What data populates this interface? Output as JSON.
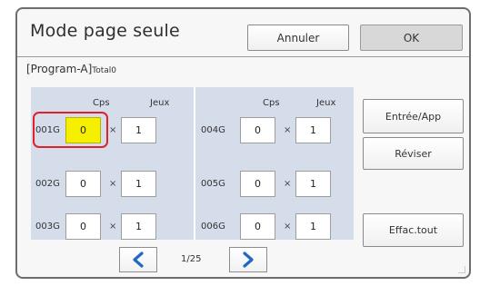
{
  "dialog": {
    "title": "Mode page seule",
    "cancel_label": "Annuler",
    "ok_label": "OK"
  },
  "program": {
    "name": "[Program-A]",
    "total": "Total0"
  },
  "grid": {
    "left": {
      "header_cps": "Cps",
      "header_jeux": "Jeux",
      "rows": [
        {
          "label": "001G",
          "cps": "0",
          "times": "×",
          "jeux": "1"
        },
        {
          "label": "002G",
          "cps": "0",
          "times": "×",
          "jeux": "1"
        },
        {
          "label": "003G",
          "cps": "0",
          "times": "×",
          "jeux": "1"
        }
      ]
    },
    "right": {
      "header_cps": "Cps",
      "header_jeux": "Jeux",
      "rows": [
        {
          "label": "004G",
          "cps": "0",
          "times": "×",
          "jeux": "1"
        },
        {
          "label": "005G",
          "cps": "0",
          "times": "×",
          "jeux": "1"
        },
        {
          "label": "006G",
          "cps": "0",
          "times": "×",
          "jeux": "1"
        }
      ]
    }
  },
  "side_buttons": {
    "entree": "Entrée/App",
    "reviser": "Réviser",
    "effac": "Effac.tout"
  },
  "pagination": {
    "indicator": "1/25",
    "prev_icon": "chevron-left-icon",
    "next_icon": "chevron-right-icon"
  },
  "colors": {
    "selected_field": "#f6f000",
    "highlight_border": "#e0202a",
    "arrow": "#1f68c4",
    "panel_bg": "#d4dde9"
  }
}
